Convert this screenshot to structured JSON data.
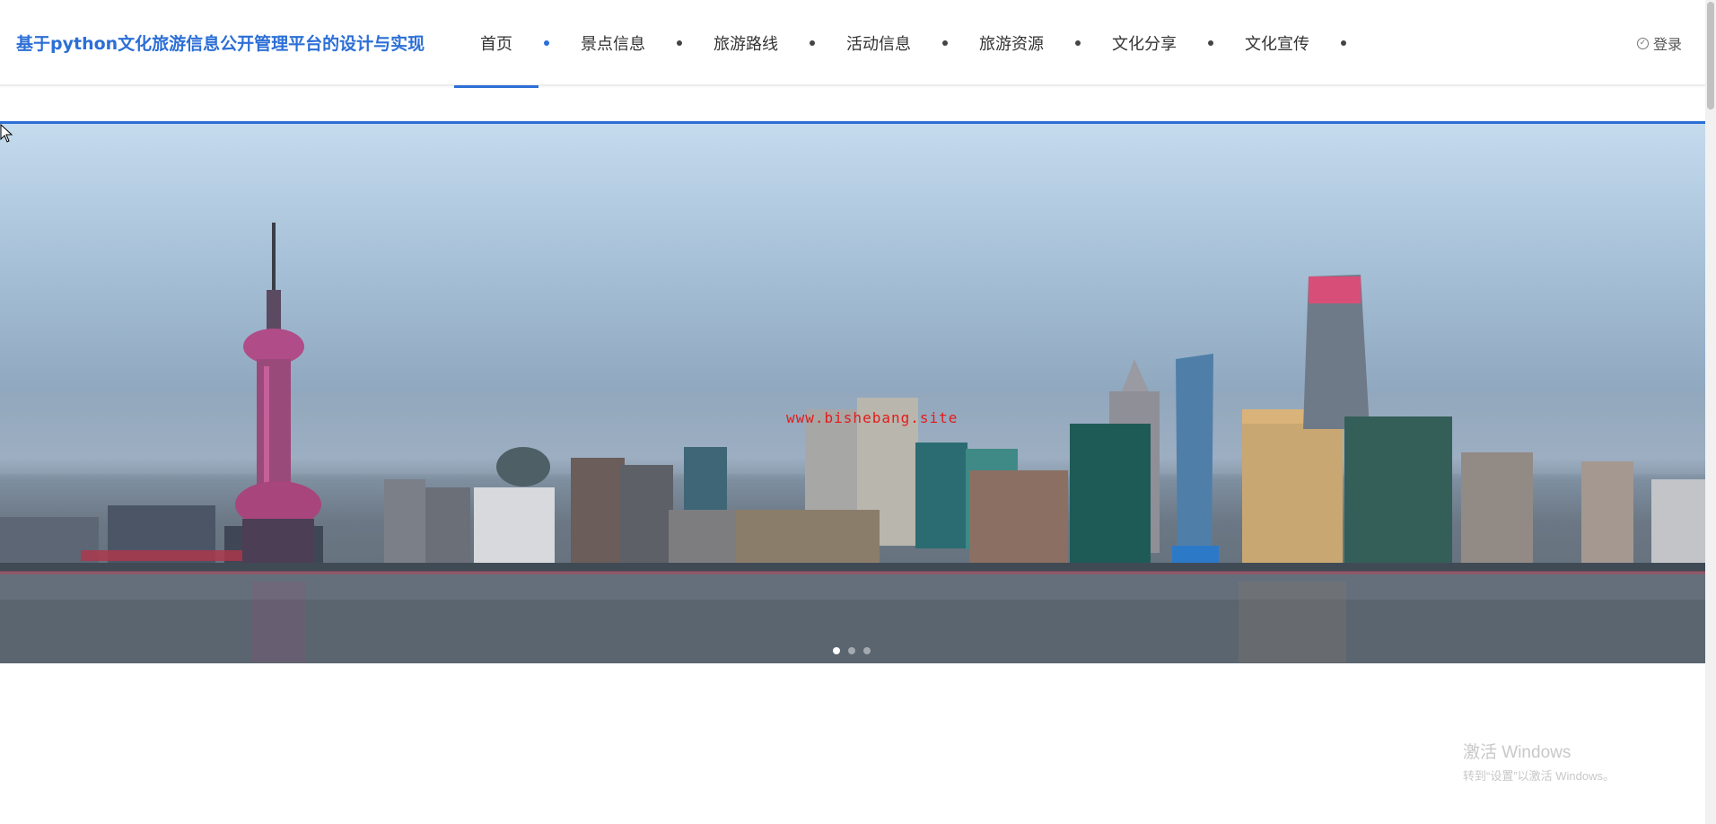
{
  "header": {
    "site_title": "基于python文化旅游信息公开管理平台的设计与实现",
    "nav": [
      {
        "label": "首页"
      },
      {
        "label": "景点信息"
      },
      {
        "label": "旅游路线"
      },
      {
        "label": "活动信息"
      },
      {
        "label": "旅游资源"
      },
      {
        "label": "文化分享"
      },
      {
        "label": "文化宣传"
      }
    ],
    "login_label": "登录",
    "login_icon": "check-circle-icon"
  },
  "banner": {
    "watermark": "www.bishebang.site",
    "slides": 3,
    "active_slide": 1
  },
  "os_watermark": {
    "line1": "激活 Windows",
    "line2": "转到“设置”以激活 Windows。"
  },
  "colors": {
    "accent": "#2c6fd6",
    "watermark": "#e31b1b"
  }
}
